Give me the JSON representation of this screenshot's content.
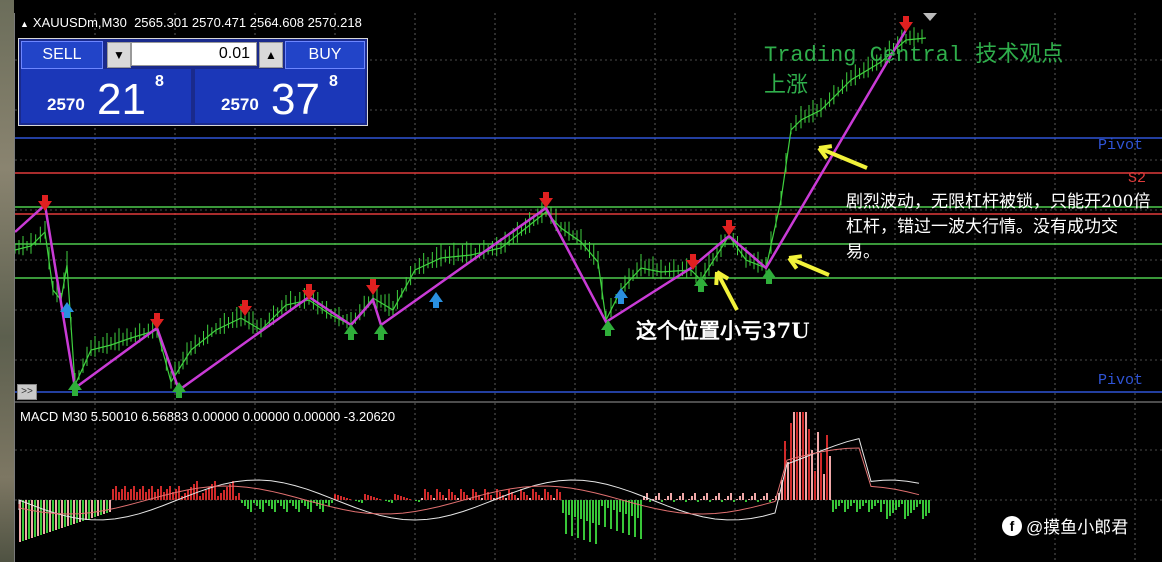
{
  "chart": {
    "symbol": "XAUUSDm,M30",
    "ohlc": "2565.301 2570.471 2564.608 2570.218"
  },
  "trade_panel": {
    "sell_label": "SELL",
    "buy_label": "BUY",
    "lot_value": "0.01",
    "sell_price": {
      "prefix": "2570",
      "big": "21",
      "sup": "8"
    },
    "buy_price": {
      "prefix": "2570",
      "big": "37",
      "sup": "8"
    }
  },
  "indicator": {
    "name": "Trading Central 技术观点",
    "direction": "上涨"
  },
  "levels": {
    "pivot_top": "Pivot",
    "s2": "S2",
    "pivot_bottom": "Pivot"
  },
  "annotations": {
    "note_right": "剧烈波动，无限杠杆被锁，只能开200倍杠杆，错过一波大行情。没有成功交易。",
    "note_mid": "这个位置小亏37U"
  },
  "macd": {
    "header": "MACD M30 5.50010 6.56883 0.00000 0.00000 0.00000 -3.20620"
  },
  "scroll_button": ">>",
  "watermark": {
    "logo": "f",
    "text": "@摸鱼小郎君"
  },
  "colors": {
    "zigzag": "#c93bd6",
    "pivot_line": "#2f54d6",
    "resistance_line": "#e03b3b",
    "support_line": "#4ecb4e",
    "candle": "#3fd13f",
    "sell_arrow": "#e02020",
    "buy_arrow": "#2fae3a",
    "blue_arrow": "#2a90e0",
    "annotation_arrow": "#f2f23a",
    "macd_bear": "#38c638",
    "macd_bull": "#d12a2a",
    "macd_light": "#f0a8a8"
  }
}
